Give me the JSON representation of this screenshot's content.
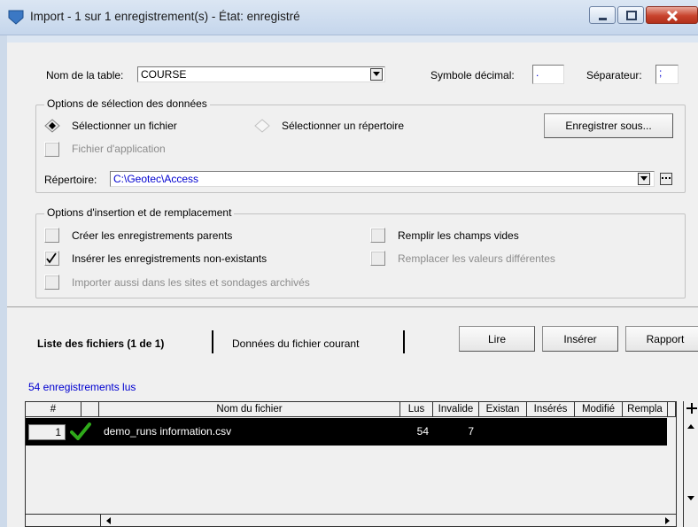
{
  "window": {
    "title": "Import - 1 sur 1 enregistrement(s) - État: enregistré"
  },
  "table_row": {
    "table_label": "Nom de la table:",
    "table_value": "COURSE",
    "decimal_label": "Symbole décimal:",
    "decimal_value": ".",
    "separator_label": "Séparateur:",
    "separator_value": ";"
  },
  "selection_group": {
    "legend": "Options de sélection des données",
    "select_file": "Sélectionner un fichier",
    "select_file_selected": true,
    "select_dir": "Sélectionner un répertoire",
    "save_as": "Enregistrer sous...",
    "app_file": "Fichier d'application",
    "dir_label": "Répertoire:",
    "dir_value": "C:\\Geotec\\Access"
  },
  "insert_group": {
    "legend": "Options d'insertion et de remplacement",
    "create_parents": "Créer les enregistrements parents",
    "insert_nonexisting": "Insérer les enregistrements non-existants",
    "import_archived": "Importer aussi dans les sites et sondages archivés",
    "fill_empty": "Remplir les champs vides",
    "replace_different": "Remplacer les valeurs différentes"
  },
  "tabs": {
    "files": "Liste des fichiers (1 de 1)",
    "current": "Données du fichier courant"
  },
  "actions": {
    "read": "Lire",
    "insert": "Insérer",
    "report": "Rapport"
  },
  "status": "54 enregistrements lus",
  "grid": {
    "headers": {
      "num": "#",
      "file": "Nom du fichier",
      "lus": "Lus",
      "invalid": "Invalide",
      "existing": "Existan",
      "inserted": "Insérés",
      "modified": "Modifié",
      "replaced": "Rempla"
    },
    "rows": [
      {
        "num": "1",
        "file": "demo_runs information.csv",
        "lus": "54",
        "invalid": "7"
      }
    ]
  },
  "colors": {
    "title_icon": "#3b78c4",
    "link_blue": "#0000d0",
    "check_green": "#2faa1a"
  }
}
